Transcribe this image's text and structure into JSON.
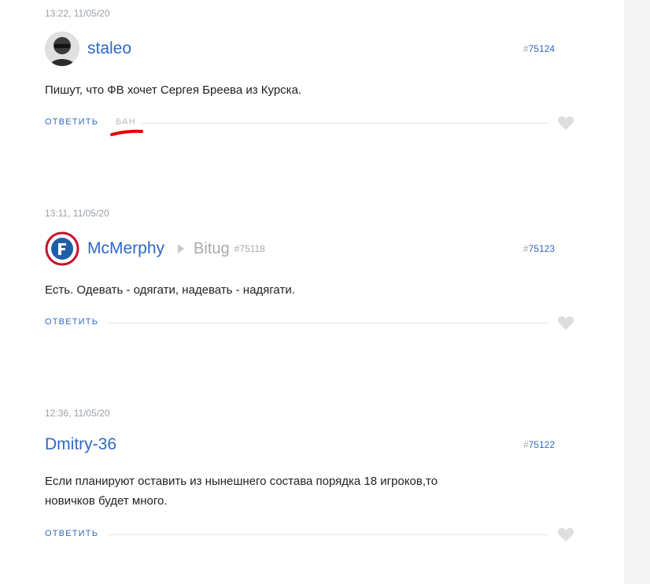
{
  "colors": {
    "link": "#2f68c9",
    "muted": "#9aa0a6",
    "annotation": "#e60000"
  },
  "comments": [
    {
      "timestamp": "13:22, 11/05/20",
      "author": "staleo",
      "avatar_icon": "user-avatar-photo",
      "number_hash": "#",
      "number": "75124",
      "text": "Пишут, что ФВ хочет Сергея Бреева из Курска.",
      "reply_label": "ответить",
      "ban_label": "бан"
    },
    {
      "timestamp": "13:11, 11/05/20",
      "author": "McMerphy",
      "avatar_icon": "club-logo-avatar",
      "reply_to_author": "Bitug",
      "reply_to_number": "#75118",
      "number_hash": "#",
      "number": "75123",
      "text": "Есть. Одевать - одягати, надевать - надягати.",
      "reply_label": "ответить"
    },
    {
      "timestamp": "12:36, 11/05/20",
      "author": "Dmitry-36",
      "number_hash": "#",
      "number": "75122",
      "text_line1": "Если планируют оставить из нынешнего состава порядка 18 игроков,то",
      "text_line2": "новичков будет много.",
      "reply_label": "ответить"
    }
  ]
}
